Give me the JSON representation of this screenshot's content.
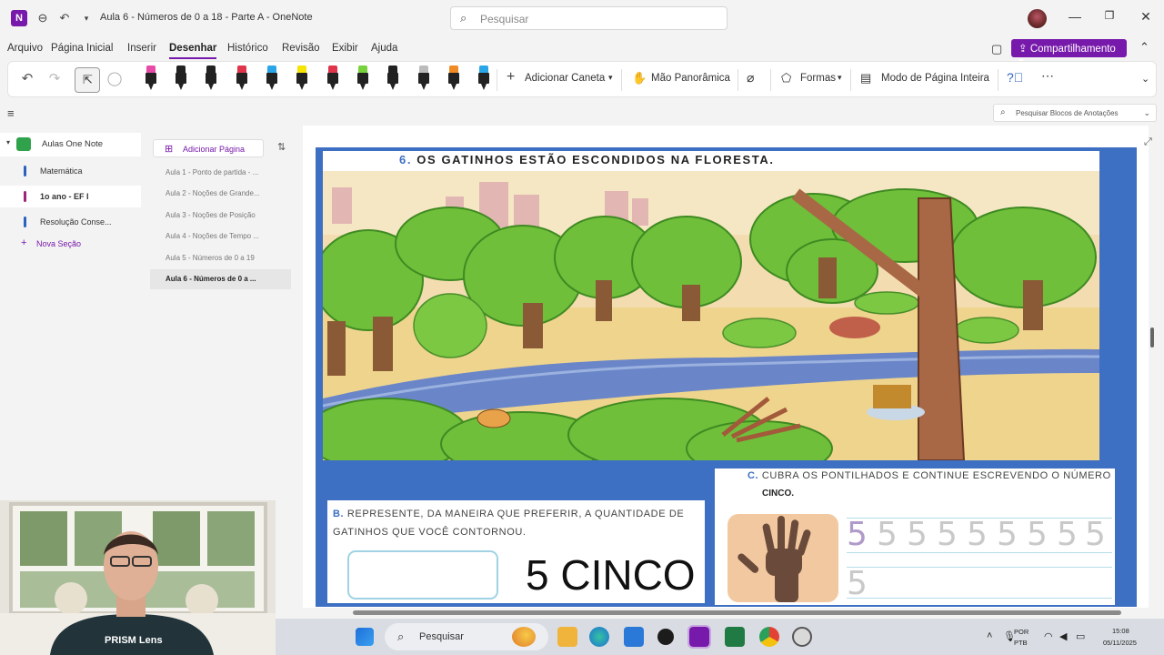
{
  "titlebar": {
    "doc_title": "Aula 6 - Números de 0 a 18 - Parte A - OneNote",
    "search_placeholder": "Pesquisar"
  },
  "menu": {
    "items": [
      "Arquivo",
      "Página Inicial",
      "Inserir",
      "Desenhar",
      "Histórico",
      "Revisão",
      "Exibir",
      "Ajuda"
    ],
    "active": "Desenhar",
    "share_label": "Compartilhamento"
  },
  "ribbon": {
    "add_pen_label": "Adicionar Caneta",
    "panning_label": "Mão Panorâmica",
    "shapes_label": "Formas",
    "full_page_label": "Modo de Página Inteira",
    "pens": [
      {
        "cap": "#e84aa8"
      },
      {
        "cap": "#222222"
      },
      {
        "cap": "#222222"
      },
      {
        "cap": "#e0344b"
      },
      {
        "cap": "#2aa6e8"
      },
      {
        "cap": "#f5e500"
      },
      {
        "cap": "#e0344b"
      },
      {
        "cap": "#78d23c"
      },
      {
        "cap": "#222222"
      },
      {
        "cap": "#bbbbbb"
      },
      {
        "cap": "#f08a24"
      },
      {
        "cap": "#2aa6e8"
      }
    ]
  },
  "toolbar2": {
    "search_annotations": "Pesquisar Blocos de Anotações"
  },
  "sidebar": {
    "notebook": "Aulas One Note",
    "sections": [
      {
        "label": "Matemática",
        "color": "#2b62c2"
      },
      {
        "label": "1o ano - EF I",
        "color": "#a0227a"
      },
      {
        "label": "Resolução Conse...",
        "color": "#2b62c2"
      }
    ],
    "new_section": "Nova Seção"
  },
  "pages": {
    "add_page": "Adicionar Página",
    "items": [
      "Aula 1 - Ponto de partida - ...",
      "Aula 2 - Noções de Grande...",
      "Aula 3 - Noções de Posição",
      "Aula 4 - Noções de Tempo ...",
      "Aula 5 - Números de 0 a 19",
      "Aula 6 - Números de 0 a ..."
    ],
    "selected_index": 5
  },
  "document": {
    "title_num": "6.",
    "title": "OS GATINHOS ESTÃO ESCONDIDOS NA FLORESTA.",
    "q_b_letter": "B.",
    "q_b_text": "REPRESENTE, DA MANEIRA QUE PREFERIR, A QUANTIDADE DE GATINHOS QUE VOCÊ CONTORNOU.",
    "answer": "5 CINCO",
    "q_c_letter": "C.",
    "q_c_text": "CUBRA OS PONTILHADOS E CONTINUE ESCREVENDO O NÚMERO",
    "q_c_word": "CINCO.",
    "tracing_digits": [
      "5",
      "5",
      "5",
      "5",
      "5",
      "5",
      "5",
      "5",
      "5"
    ],
    "second_row_digit": "5"
  },
  "webcam": {
    "label": "PRISM Lens"
  },
  "taskbar": {
    "search_placeholder": "Pesquisar",
    "lang_top": "POR",
    "lang_bottom": "PTB",
    "time": "15:08",
    "date": "05/11/2025"
  }
}
